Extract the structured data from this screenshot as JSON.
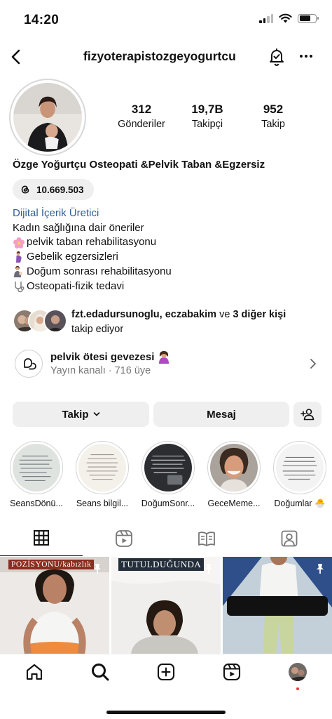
{
  "status_bar": {
    "time": "14:20"
  },
  "nav": {
    "username": "fizyoterapistozgeyogurtcu",
    "back_icon": "chevron-left-icon",
    "bell_icon": "notification-bell-icon",
    "more_icon": "more-horizontal-icon"
  },
  "profile": {
    "stats": [
      {
        "value": "312",
        "label": "Gönderiler"
      },
      {
        "value": "19,7B",
        "label": "Takipçi"
      },
      {
        "value": "952",
        "label": "Takip"
      }
    ],
    "full_name": "Özge Yoğurtçu Osteopati &Pelvik Taban &Egzersiz",
    "threads_count": "10.669.503",
    "category": "Dijital İçerik Üretici",
    "bio_lines": [
      "Kadın sağlığına dair öneriler",
      "pelvik taban rehabilitasyonu",
      "Gebelik egzersizleri",
      "Doğum sonrası rehabilitasyonu",
      "Osteopati-fizik tedavi"
    ]
  },
  "followed_by": {
    "names": "fzt.edadursunoglu, eczabakim",
    "connector": "ve",
    "others": "3 diğer kişi",
    "suffix": "takip ediyor"
  },
  "channel": {
    "name": "pelvik ötesi gevezesi",
    "subtitle": "Yayın kanalı · 716 üye"
  },
  "actions": {
    "follow_label": "Takip",
    "message_label": "Mesaj"
  },
  "highlights": [
    {
      "label": "SeansDönü..."
    },
    {
      "label": "Seans bilgil..."
    },
    {
      "label": "DoğumSonr..."
    },
    {
      "label": "GeceMeme..."
    },
    {
      "label": "Doğumlar 🐣"
    }
  ],
  "grid": {
    "post1_caption": "POZİSYONU/kabızlık",
    "post2_caption": "TUTULDUĞUNDA"
  },
  "colors": {
    "category_link": "#2f5e95",
    "button_bg": "#efefef",
    "notification_dot": "#ff3040"
  }
}
